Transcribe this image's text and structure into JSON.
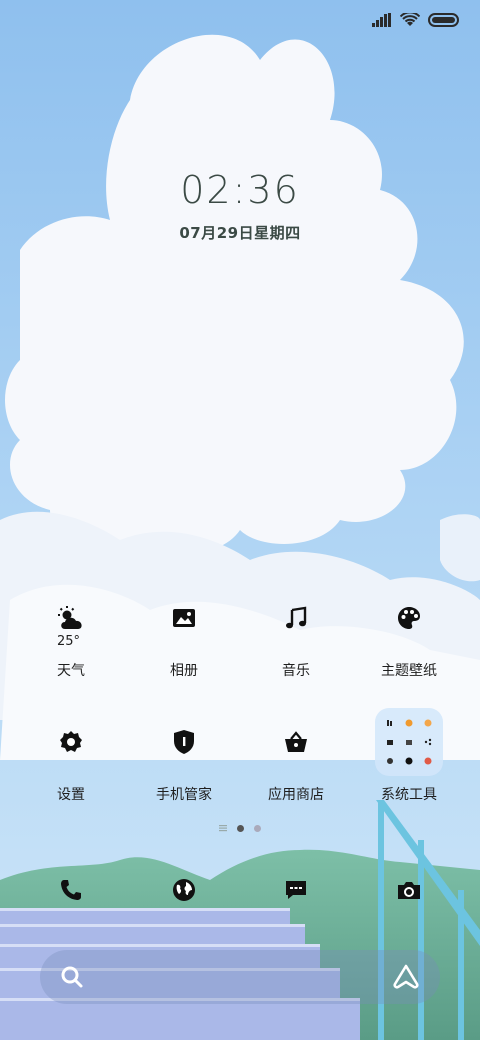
{
  "lockscreen": {
    "time": "02:36",
    "date": "07月29日星期四"
  },
  "apps_row1": [
    {
      "label": "天气",
      "icon": "weather-icon"
    },
    {
      "label": "相册",
      "icon": "gallery-icon"
    },
    {
      "label": "音乐",
      "icon": "music-icon"
    },
    {
      "label": "主题壁纸",
      "icon": "palette-icon"
    }
  ],
  "weather": {
    "temp": "25°"
  },
  "apps_row2": [
    {
      "label": "设置",
      "icon": "gear-icon"
    },
    {
      "label": "手机管家",
      "icon": "shield-icon"
    },
    {
      "label": "应用商店",
      "icon": "basket-icon"
    },
    {
      "label": "系统工具",
      "icon": "folder-icon"
    }
  ],
  "dock": [
    {
      "icon": "phone-icon"
    },
    {
      "icon": "browser-icon"
    },
    {
      "icon": "message-icon"
    },
    {
      "icon": "camera-icon"
    }
  ],
  "page_indicator": {
    "pages": 3,
    "current": 1
  },
  "search": {
    "icon": "search-icon",
    "assistant_icon": "assistant-icon"
  },
  "colors": {
    "text": "#1f1f1f",
    "clock": "#3b4a45",
    "sky": "#8fc0ee"
  }
}
